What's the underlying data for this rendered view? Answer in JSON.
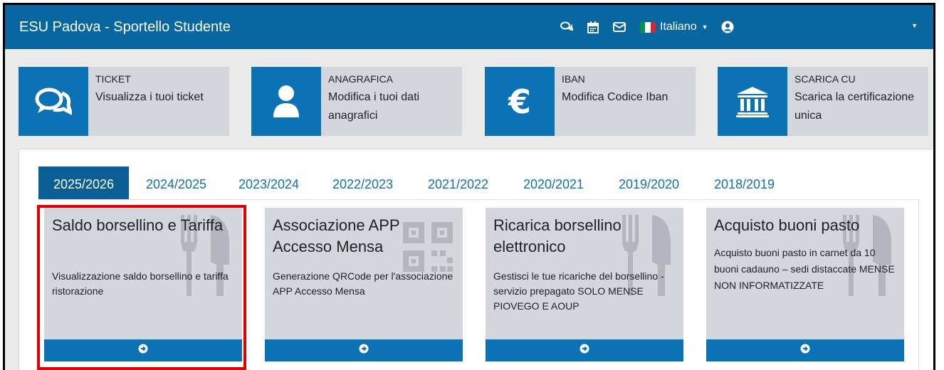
{
  "header": {
    "title": "ESU Padova - Sportello Studente",
    "language": "Italiano",
    "icons": [
      "comments-icon",
      "calendar-icon",
      "envelope-icon",
      "italy-flag-icon",
      "user-circle-icon",
      "caret-down-icon"
    ],
    "flag_colors": [
      "#009246",
      "#ffffff",
      "#ce2b37"
    ]
  },
  "top_cards": [
    {
      "title": "TICKET",
      "description": "Visualizza i tuoi ticket",
      "icon": "comments-icon"
    },
    {
      "title": "ANAGRAFICA",
      "description": "Modifica i tuoi dati anagrafici",
      "icon": "user-icon"
    },
    {
      "title": "IBAN",
      "description": "Modifica Codice Iban",
      "icon": "euro-icon"
    },
    {
      "title": "SCARICA CU",
      "description": "Scarica la certificazione unica",
      "icon": "bank-icon"
    }
  ],
  "tabs": [
    {
      "label": "2025/2026",
      "active": true
    },
    {
      "label": "2024/2025",
      "active": false
    },
    {
      "label": "2023/2024",
      "active": false
    },
    {
      "label": "2022/2023",
      "active": false
    },
    {
      "label": "2021/2022",
      "active": false
    },
    {
      "label": "2020/2021",
      "active": false
    },
    {
      "label": "2019/2020",
      "active": false
    },
    {
      "label": "2018/2019",
      "active": false
    }
  ],
  "service_cards": [
    {
      "title": "Saldo borsellino e Tariffa",
      "description": "Visualizzazione saldo borsellino e tariffa ristorazione",
      "background_icon": "cutlery-icon",
      "button_icon": "arrow-circle-right-icon",
      "highlighted": true
    },
    {
      "title": "Associazione APP Accesso Mensa",
      "description": "Generazione QRCode per l'associazione APP Accesso Mensa",
      "background_icon": "qrcode-icon",
      "button_icon": "arrow-circle-right-icon",
      "highlighted": false
    },
    {
      "title": "Ricarica borsellino elettronico",
      "description": "Gestisci le tue ricariche del borsellino - servizio prepagato SOLO MENSE PIOVEGO E AOUP",
      "background_icon": "cutlery-icon",
      "button_icon": "arrow-circle-right-icon",
      "highlighted": false
    },
    {
      "title": "Acquisto buoni pasto",
      "description": "Acquisto buoni pasto in carnet da 10 buoni cadauno – sedi distaccate MENSE NON INFORMATIZZATE",
      "background_icon": "cutlery-icon",
      "button_icon": "arrow-circle-right-icon",
      "highlighted": false
    }
  ],
  "colors": {
    "navbar": "#0866a0",
    "accent": "#0b73b5",
    "card_bg": "#d4d6dd",
    "active_tab": "#0b5f96",
    "highlight": "#e00000"
  }
}
